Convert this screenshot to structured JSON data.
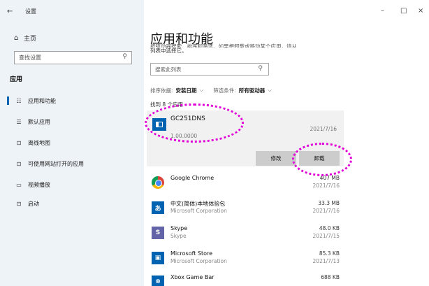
{
  "window": {
    "back": "←",
    "title": "设置",
    "controls": {
      "minimize": "–",
      "maximize": "□",
      "close": "×"
    }
  },
  "sidebar": {
    "home": "主页",
    "search_placeholder": "查找设置",
    "section": "应用",
    "items": [
      {
        "icon": "☷",
        "label": "应用和功能"
      },
      {
        "icon": "☰",
        "label": "默认应用"
      },
      {
        "icon": "⊡",
        "label": "离线地图"
      },
      {
        "icon": "⊡",
        "label": "可使用网站打开的应用"
      },
      {
        "icon": "▭",
        "label": "视频播放"
      },
      {
        "icon": "⊡",
        "label": "启动"
      }
    ]
  },
  "main": {
    "title": "应用和功能",
    "description_line1": "按驱动器搜索、排序和筛选。如果想卸载或移动某个应用，请从",
    "description_line2": "列表中选择它。",
    "list_search_placeholder": "搜索此列表",
    "sort_label": "排序依据:",
    "sort_value": "安装日期",
    "filter_label": "筛选条件:",
    "filter_value": "所有驱动器",
    "found_text": "找到 8 个应用",
    "selected": {
      "name": "GC251DNS",
      "version": "1.00.0000",
      "date": "2021/7/16",
      "modify": "修改",
      "uninstall": "卸载"
    },
    "apps": [
      {
        "name": "Google Chrome",
        "publisher": "",
        "size": "407 MB",
        "date": "2021/7/16",
        "icon": "chrome",
        "color": "#ffffff"
      },
      {
        "name": "中文(简体)本地体验包",
        "publisher": "Microsoft Corporation",
        "size": "33.3 MB",
        "date": "2021/7/16",
        "icon": "あ",
        "color": "#0063b1"
      },
      {
        "name": "Skype",
        "publisher": "Skype",
        "size": "48.0 KB",
        "date": "2021/7/15",
        "icon": "S",
        "color": "#6264a7"
      },
      {
        "name": "Microsoft Store",
        "publisher": "Microsoft Corporation",
        "size": "85.3 KB",
        "date": "2021/7/13",
        "icon": "🛍",
        "color": "#0063b1"
      },
      {
        "name": "Xbox Game Bar",
        "publisher": "",
        "size": "688 KB",
        "date": "",
        "icon": "⊗",
        "color": "#0063b1"
      }
    ]
  }
}
